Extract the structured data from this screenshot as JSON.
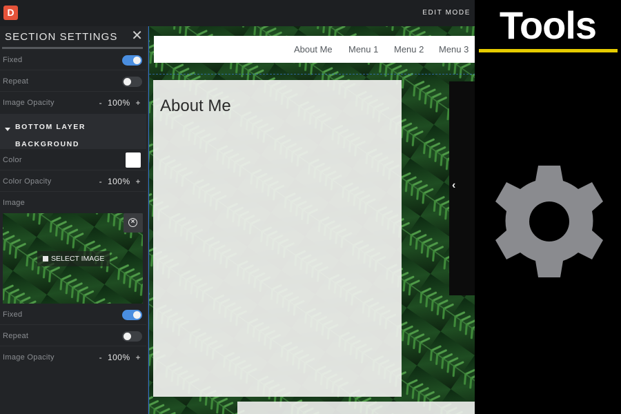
{
  "topbar": {
    "logo_letter": "D",
    "edit_mode": "EDIT MODE"
  },
  "panel": {
    "title": "SECTION SETTINGS",
    "close_glyph": "✕",
    "rows_top": [
      {
        "label": "Fixed",
        "toggle": true
      },
      {
        "label": "Repeat",
        "toggle": false
      }
    ],
    "image_opacity_top": {
      "label": "Image Opacity",
      "minus": "-",
      "value": "100%",
      "plus": "+"
    },
    "section_heading": {
      "line1": "BOTTOM LAYER",
      "line2": "BACKGROUND"
    },
    "color_label": "Color",
    "color_value": "#ffffff",
    "color_opacity": {
      "label": "Color Opacity",
      "minus": "-",
      "value": "100%",
      "plus": "+"
    },
    "image_label": "Image",
    "select_image": "SELECT IMAGE",
    "rows_bottom": [
      {
        "label": "Fixed",
        "toggle": true
      },
      {
        "label": "Repeat",
        "toggle": false
      }
    ],
    "image_opacity_bottom": {
      "label": "Image Opacity",
      "minus": "-",
      "value": "100%",
      "plus": "+"
    }
  },
  "canvas": {
    "nav": [
      "About Me",
      "Menu 1",
      "Menu 2",
      "Menu 3"
    ],
    "about_title": "About Me",
    "slide_arrow": "‹"
  },
  "tools": {
    "title": "Tools",
    "accent": "#e6cc00",
    "gear_color": "#8a8b8f",
    "icon": "gear-icon"
  },
  "colors": {
    "toggle_on": "#4a8ee0",
    "logo": "#e5533a",
    "selection_outline": "#3a7bd5"
  }
}
